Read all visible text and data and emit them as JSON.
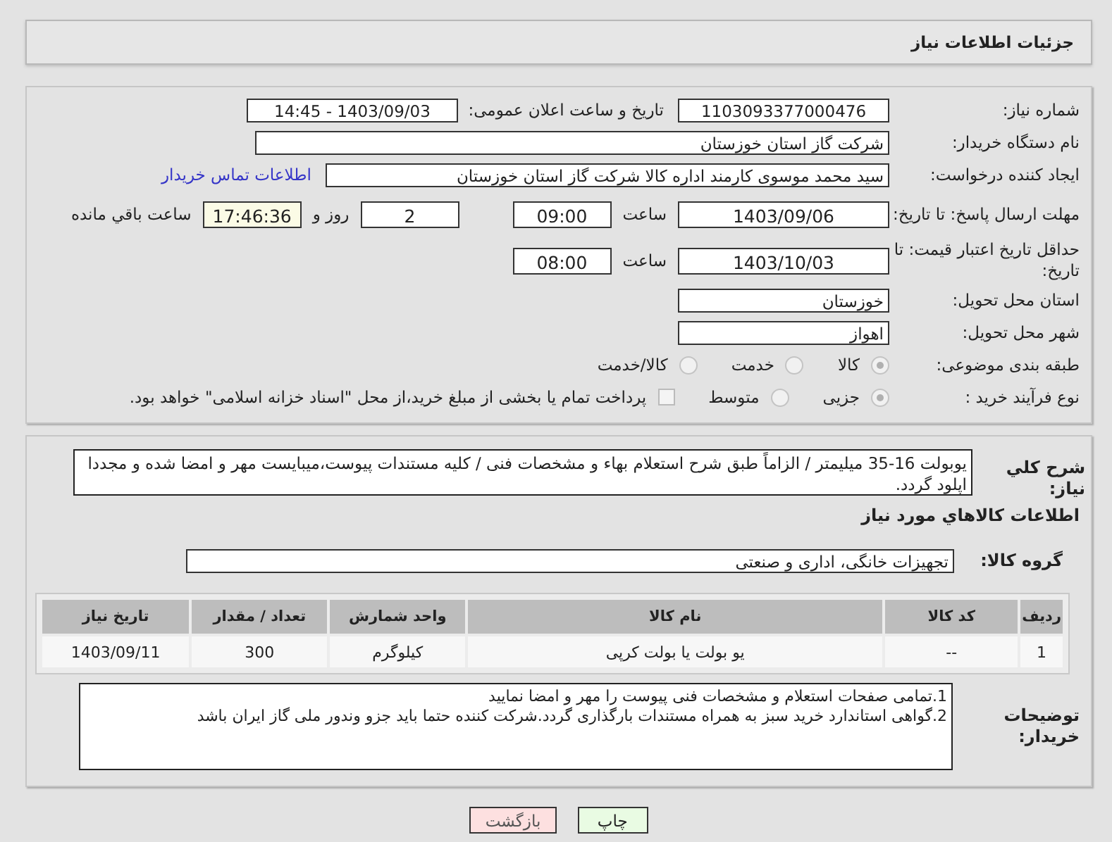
{
  "header": {
    "title": "جزئیات اطلاعات نیاز"
  },
  "need_number": {
    "label": "شماره نیاز:",
    "value": "1103093377000476"
  },
  "announce": {
    "label": "تاریخ و ساعت اعلان عمومی:",
    "value": "1403/09/03 - 14:45"
  },
  "buyer_org": {
    "label": "نام دستگاه خریدار:",
    "value": "شرکت گاز استان خوزستان"
  },
  "creator": {
    "label": "ایجاد کننده درخواست:",
    "value": "سید محمد موسوی کارمند اداره کالا شرکت گاز استان خوزستان",
    "link": "اطلاعات تماس خریدار"
  },
  "reply_deadline": {
    "label": "مهلت ارسال پاسخ: تا تاریخ:",
    "date": "1403/09/06",
    "time_label": "ساعت",
    "time": "09:00",
    "days": "2",
    "days_label": "روز و",
    "remaining": "17:46:36",
    "remaining_label": "ساعت باقي مانده"
  },
  "price_validity": {
    "label": "حداقل تاریخ اعتبار قیمت: تا تاریخ:",
    "date": "1403/10/03",
    "time_label": "ساعت",
    "time": "08:00"
  },
  "province": {
    "label": "استان محل تحویل:",
    "value": "خوزستان"
  },
  "city": {
    "label": "شهر محل تحویل:",
    "value": "اهواز"
  },
  "category": {
    "label": "طبقه بندی موضوعی:",
    "options": [
      {
        "label": "کالا",
        "selected": true
      },
      {
        "label": "خدمت",
        "selected": false
      },
      {
        "label": "کالا/خدمت",
        "selected": false
      }
    ]
  },
  "purchase_type": {
    "label": "نوع فرآیند خرید :",
    "options": [
      {
        "label": "جزیی",
        "selected": true
      },
      {
        "label": "متوسط",
        "selected": false
      }
    ],
    "treasury": {
      "label": "پرداخت تمام یا بخشی از مبلغ خرید،از محل \"اسناد خزانه اسلامی\" خواهد بود.",
      "checked": false
    }
  },
  "description": {
    "label": "شرح کلي نياز:",
    "value": "یوبولت 16-35 میلیمتر / الزاماً طبق شرح استعلام بهاء و مشخصات فنی / کلیه مستندات پیوست،میبایست مهر و امضا شده و مجددا اپلود گردد."
  },
  "goods_heading": "اطلاعات كالاهاي مورد نياز",
  "goods_group": {
    "label": "گروه کالا:",
    "value": "تجهیزات خانگی، اداری و صنعتی"
  },
  "table": {
    "columns": [
      "ردیف",
      "کد کالا",
      "نام کالا",
      "واحد شمارش",
      "تعداد / مقدار",
      "تاریخ نیاز"
    ],
    "rows": [
      [
        "1",
        "--",
        "یو بولت یا بولت کرپی",
        "کیلوگرم",
        "300",
        "1403/09/11"
      ]
    ]
  },
  "buyer_notes": {
    "label": "توضیحات خریدار:",
    "lines": [
      "1.تمامی صفحات استعلام و مشخصات فنی پیوست را مهر و امضا نمایید",
      "2.گواهی استاندارد خرید سبز به همراه مستندات بارگذاری گردد.شرکت کننده حتما باید جزو وندور ملی گاز ایران باشد"
    ]
  },
  "buttons": [
    {
      "label": "چاپ",
      "kind": "print"
    },
    {
      "label": "بازگشت",
      "kind": "back"
    }
  ]
}
